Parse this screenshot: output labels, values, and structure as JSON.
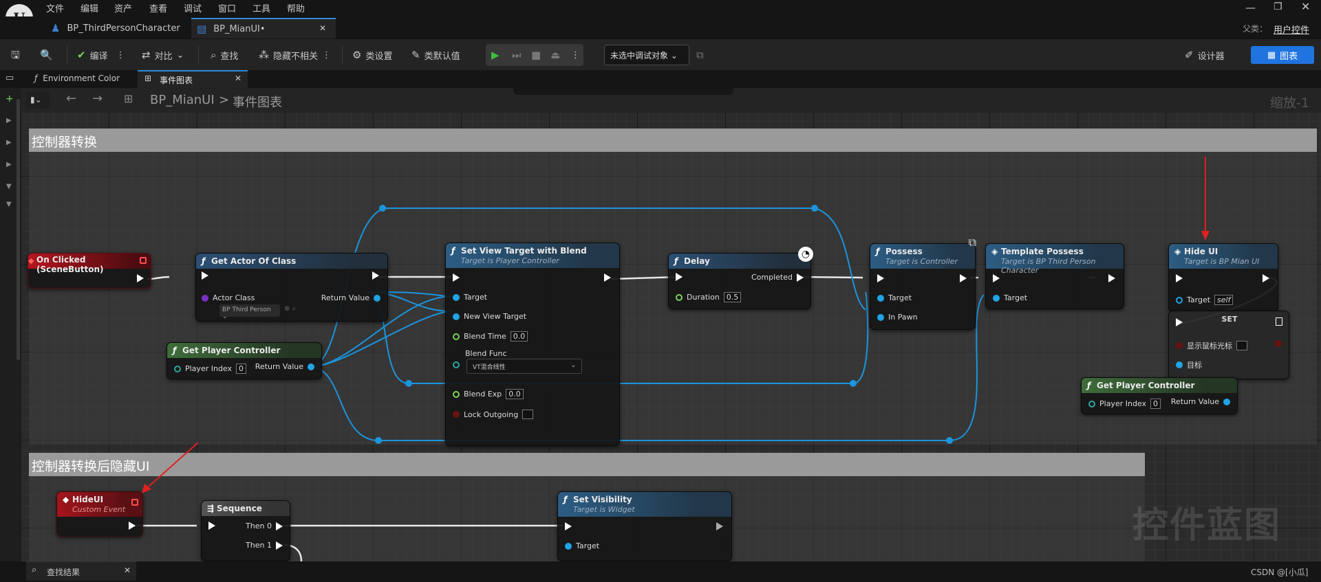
{
  "menu": [
    "文件",
    "编辑",
    "资产",
    "查看",
    "调试",
    "窗口",
    "工具",
    "帮助"
  ],
  "tabs": [
    {
      "label": "BP_ThirdPersonCharacter"
    },
    {
      "label": "BP_MianUI•"
    }
  ],
  "parent_class": {
    "label": "父类：",
    "value": "用户控件"
  },
  "toolbar": {
    "compile": "编译",
    "diff": "对比",
    "find": "查找",
    "hide_unrelated": "隐藏不相关",
    "class_settings": "类设置",
    "class_defaults": "类默认值",
    "debug_object": "未选中调试对象",
    "designer": "设计器",
    "graph": "图表"
  },
  "panel_tabs": [
    {
      "label": "Environment Color"
    },
    {
      "label": "事件图表"
    }
  ],
  "breadcrumb": {
    "bp": "BP_MianUI",
    "sep": ">",
    "graph": "事件图表"
  },
  "zoom": "缩放-1",
  "watermark": "控件蓝图",
  "comments": [
    "控制器转换",
    "控制器转换后隐藏UI"
  ],
  "nodes": {
    "on_clicked": {
      "title": "On Clicked (SceneButton)"
    },
    "get_actor": {
      "title": "Get Actor Of Class",
      "actor_class": "Actor Class",
      "class_value": "BP Third Person",
      "return": "Return Value"
    },
    "get_pc1": {
      "title": "Get Player Controller",
      "player_index": "Player Index",
      "index_val": "0",
      "return": "Return Value"
    },
    "set_view": {
      "title": "Set View Target with Blend",
      "sub": "Target is Player Controller",
      "target": "Target",
      "new_view": "New View Target",
      "blend_time": "Blend Time",
      "blend_time_val": "0.0",
      "blend_func": "Blend Func",
      "blend_func_val": "VT混合线性",
      "blend_exp": "Blend Exp",
      "blend_exp_val": "0.0",
      "lock": "Lock Outgoing"
    },
    "delay": {
      "title": "Delay",
      "completed": "Completed",
      "duration": "Duration",
      "duration_val": "0.5"
    },
    "possess": {
      "title": "Possess",
      "sub": "Target is Controller",
      "target": "Target",
      "in_pawn": "In Pawn"
    },
    "template": {
      "title": "Template Possess",
      "sub": "Target is BP Third Person Character",
      "target": "Target"
    },
    "hide_ui": {
      "title": "Hide UI",
      "sub": "Target is BP Mian UI",
      "target": "Target",
      "self": "self"
    },
    "set": {
      "title": "SET",
      "show_cursor": "显示鼠标光标",
      "target": "目标"
    },
    "get_pc2": {
      "title": "Get Player Controller",
      "player_index": "Player Index",
      "index_val": "0",
      "return": "Return Value"
    },
    "hide_event": {
      "title": "HideUI",
      "sub": "Custom Event"
    },
    "sequence": {
      "title": "Sequence",
      "then0": "Then 0",
      "then1": "Then 1"
    },
    "set_vis": {
      "title": "Set Visibility",
      "sub": "Target is Widget",
      "target": "Target"
    }
  },
  "bottom": {
    "find_results": "查找结果",
    "credit": "CSDN @[小瓜]"
  }
}
